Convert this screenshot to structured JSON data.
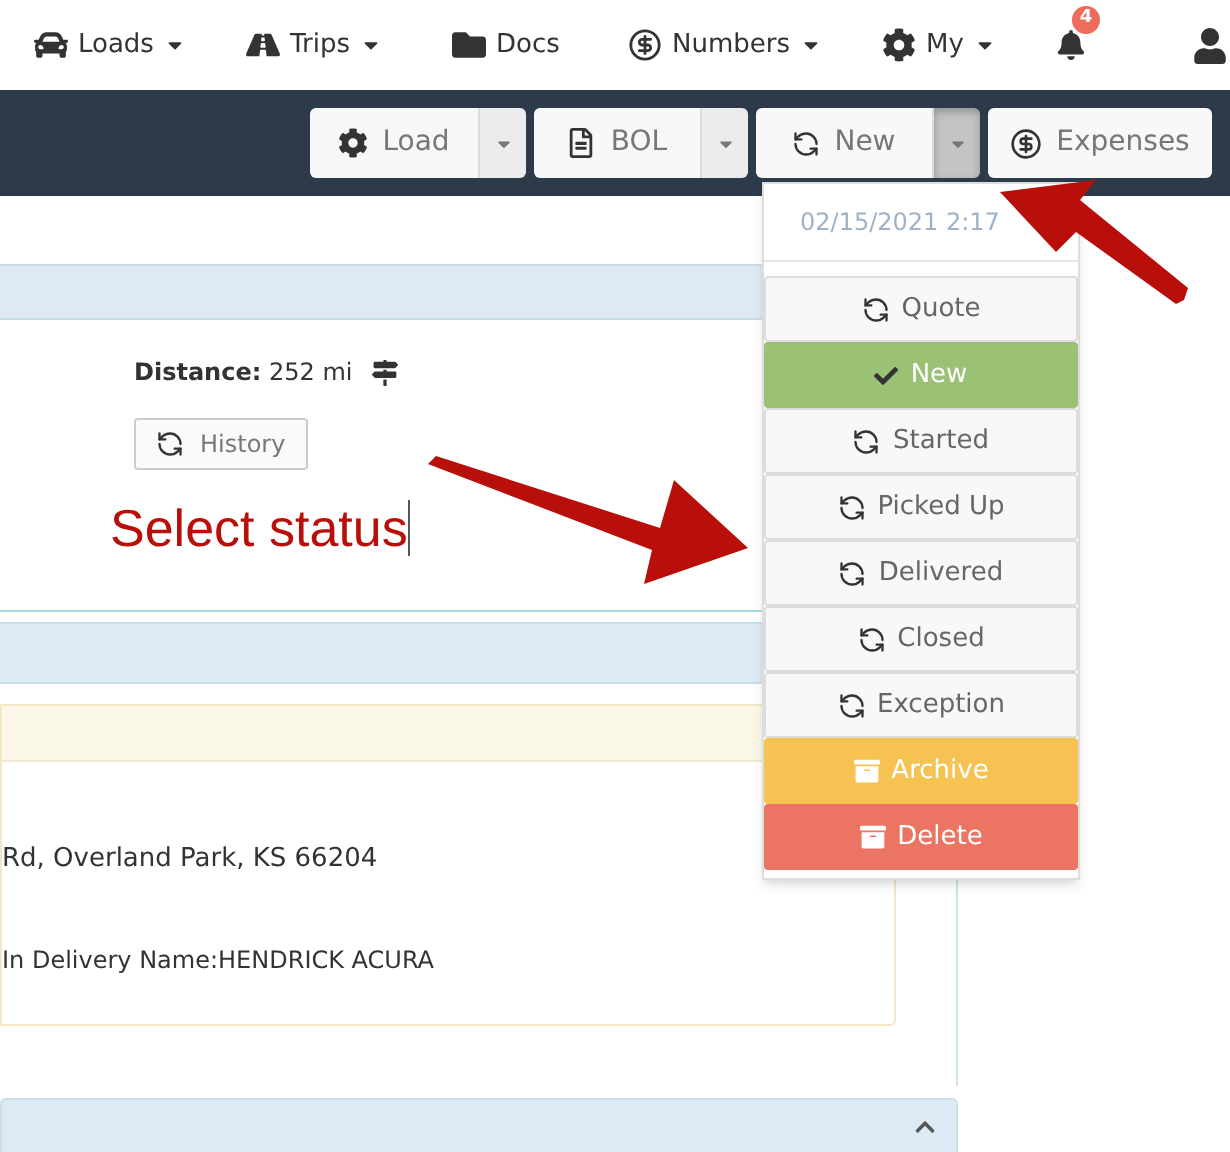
{
  "nav": {
    "items": [
      {
        "label": "Loads",
        "dropdown": true
      },
      {
        "label": "Trips",
        "dropdown": true
      },
      {
        "label": "Docs",
        "dropdown": false
      },
      {
        "label": "Numbers",
        "dropdown": true
      },
      {
        "label": "My",
        "dropdown": true
      }
    ],
    "notification_count": "4"
  },
  "toolbar": [
    {
      "label": "Load",
      "split": true,
      "pressed": false
    },
    {
      "label": "BOL",
      "split": true,
      "pressed": false
    },
    {
      "label": "New",
      "split": true,
      "pressed": true
    },
    {
      "label": "Expenses",
      "split": false,
      "pressed": false
    }
  ],
  "status_menu": {
    "timestamp": "02/15/2021 2:17",
    "items": [
      {
        "label": "Quote",
        "kind": "status",
        "selected": false
      },
      {
        "label": "New",
        "kind": "status",
        "selected": true
      },
      {
        "label": "Started",
        "kind": "status",
        "selected": false
      },
      {
        "label": "Picked Up",
        "kind": "status",
        "selected": false
      },
      {
        "label": "Delivered",
        "kind": "status",
        "selected": false
      },
      {
        "label": "Closed",
        "kind": "status",
        "selected": false
      },
      {
        "label": "Exception",
        "kind": "status",
        "selected": false
      },
      {
        "label": "Archive",
        "kind": "archive",
        "selected": false
      },
      {
        "label": "Delete",
        "kind": "delete",
        "selected": false
      }
    ]
  },
  "details": {
    "distance_label": "Distance:",
    "distance_value": "252 mi",
    "history_button": "History"
  },
  "annotation": "Select status",
  "stop": {
    "address": "Rd, Overland Park, KS 66204",
    "delivery": "In Delivery Name:HENDRICK ACURA"
  }
}
